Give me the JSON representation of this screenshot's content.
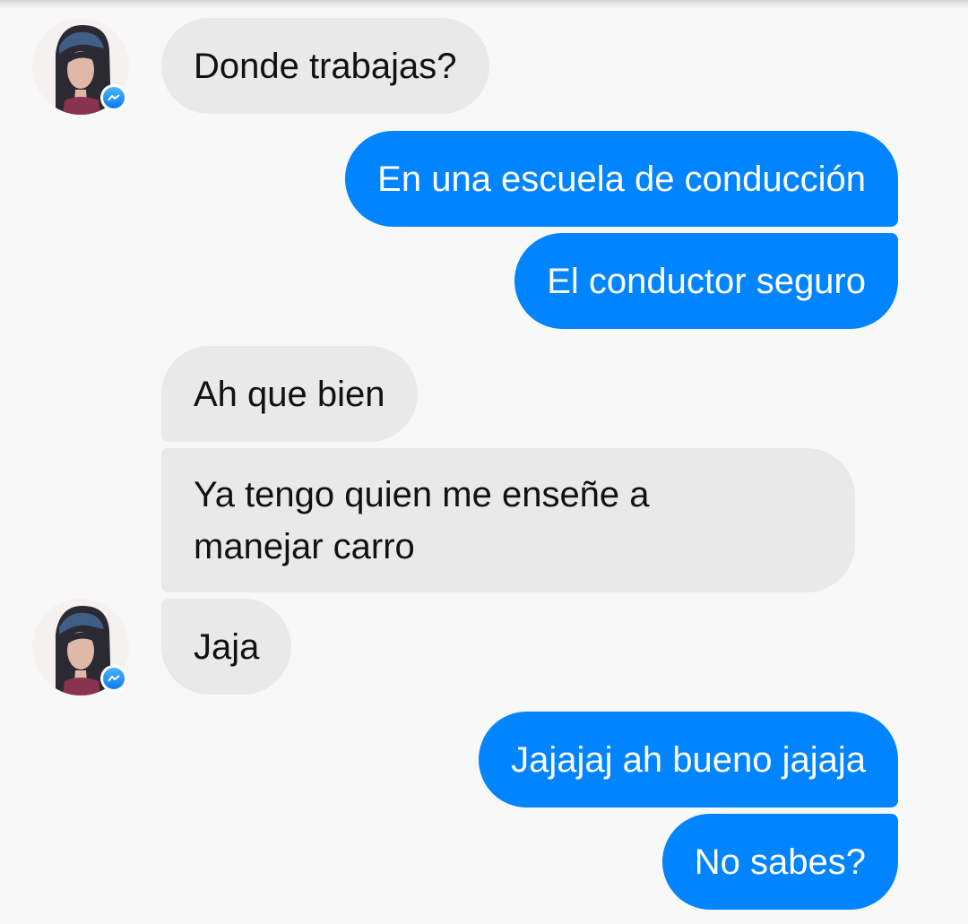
{
  "conversation": {
    "messages": [
      {
        "direction": "incoming",
        "text": "Donde trabajas?"
      },
      {
        "direction": "outgoing",
        "text": "En una escuela de conducción"
      },
      {
        "direction": "outgoing",
        "text": "El conductor seguro"
      },
      {
        "direction": "incoming",
        "text": "Ah que bien"
      },
      {
        "direction": "incoming",
        "lines": [
          "Ya tengo quien me enseñe a",
          "manejar carro"
        ]
      },
      {
        "direction": "incoming",
        "text": "Jaja"
      },
      {
        "direction": "outgoing",
        "text": "Jajajaj ah bueno jajaja"
      },
      {
        "direction": "outgoing",
        "text": "No sabes?"
      }
    ]
  },
  "icons": {
    "avatar": "contact-avatar",
    "badge": "messenger-badge-icon"
  },
  "colors": {
    "background": "#f8f8f8",
    "incoming_bubble": "#e9e9e9",
    "incoming_text": "#111111",
    "outgoing_bubble": "#0084ff",
    "outgoing_text": "#ffffff"
  }
}
